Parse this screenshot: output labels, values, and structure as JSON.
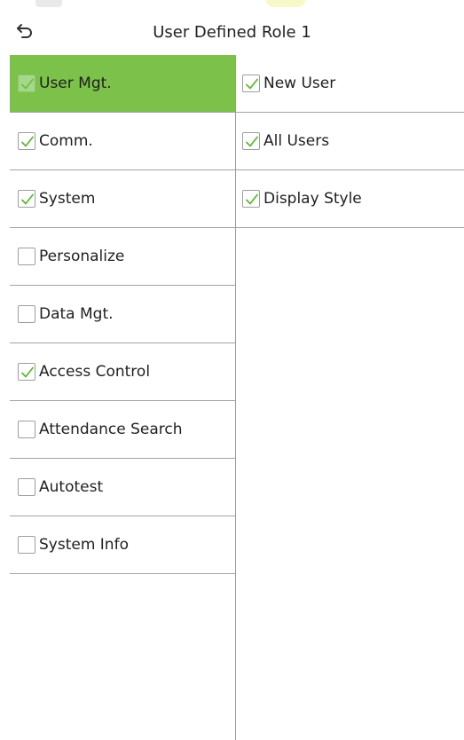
{
  "header": {
    "title": "User Defined Role 1",
    "back_icon": "back-arrow-icon"
  },
  "colors": {
    "selected_bg": "#7cc24a",
    "check": "#5cb82f",
    "divider": "#a3a3a3"
  },
  "menu": {
    "items": [
      {
        "label": "User Mgt.",
        "checked": true,
        "selected": true
      },
      {
        "label": "Comm.",
        "checked": true,
        "selected": false
      },
      {
        "label": "System",
        "checked": true,
        "selected": false
      },
      {
        "label": "Personalize",
        "checked": false,
        "selected": false
      },
      {
        "label": "Data Mgt.",
        "checked": false,
        "selected": false
      },
      {
        "label": "Access Control",
        "checked": true,
        "selected": false
      },
      {
        "label": "Attendance Search",
        "checked": false,
        "selected": false
      },
      {
        "label": "Autotest",
        "checked": false,
        "selected": false
      },
      {
        "label": "System Info",
        "checked": false,
        "selected": false
      }
    ]
  },
  "submenu": {
    "items": [
      {
        "label": "New User",
        "checked": true
      },
      {
        "label": "All Users",
        "checked": true
      },
      {
        "label": "Display Style",
        "checked": true
      }
    ]
  }
}
